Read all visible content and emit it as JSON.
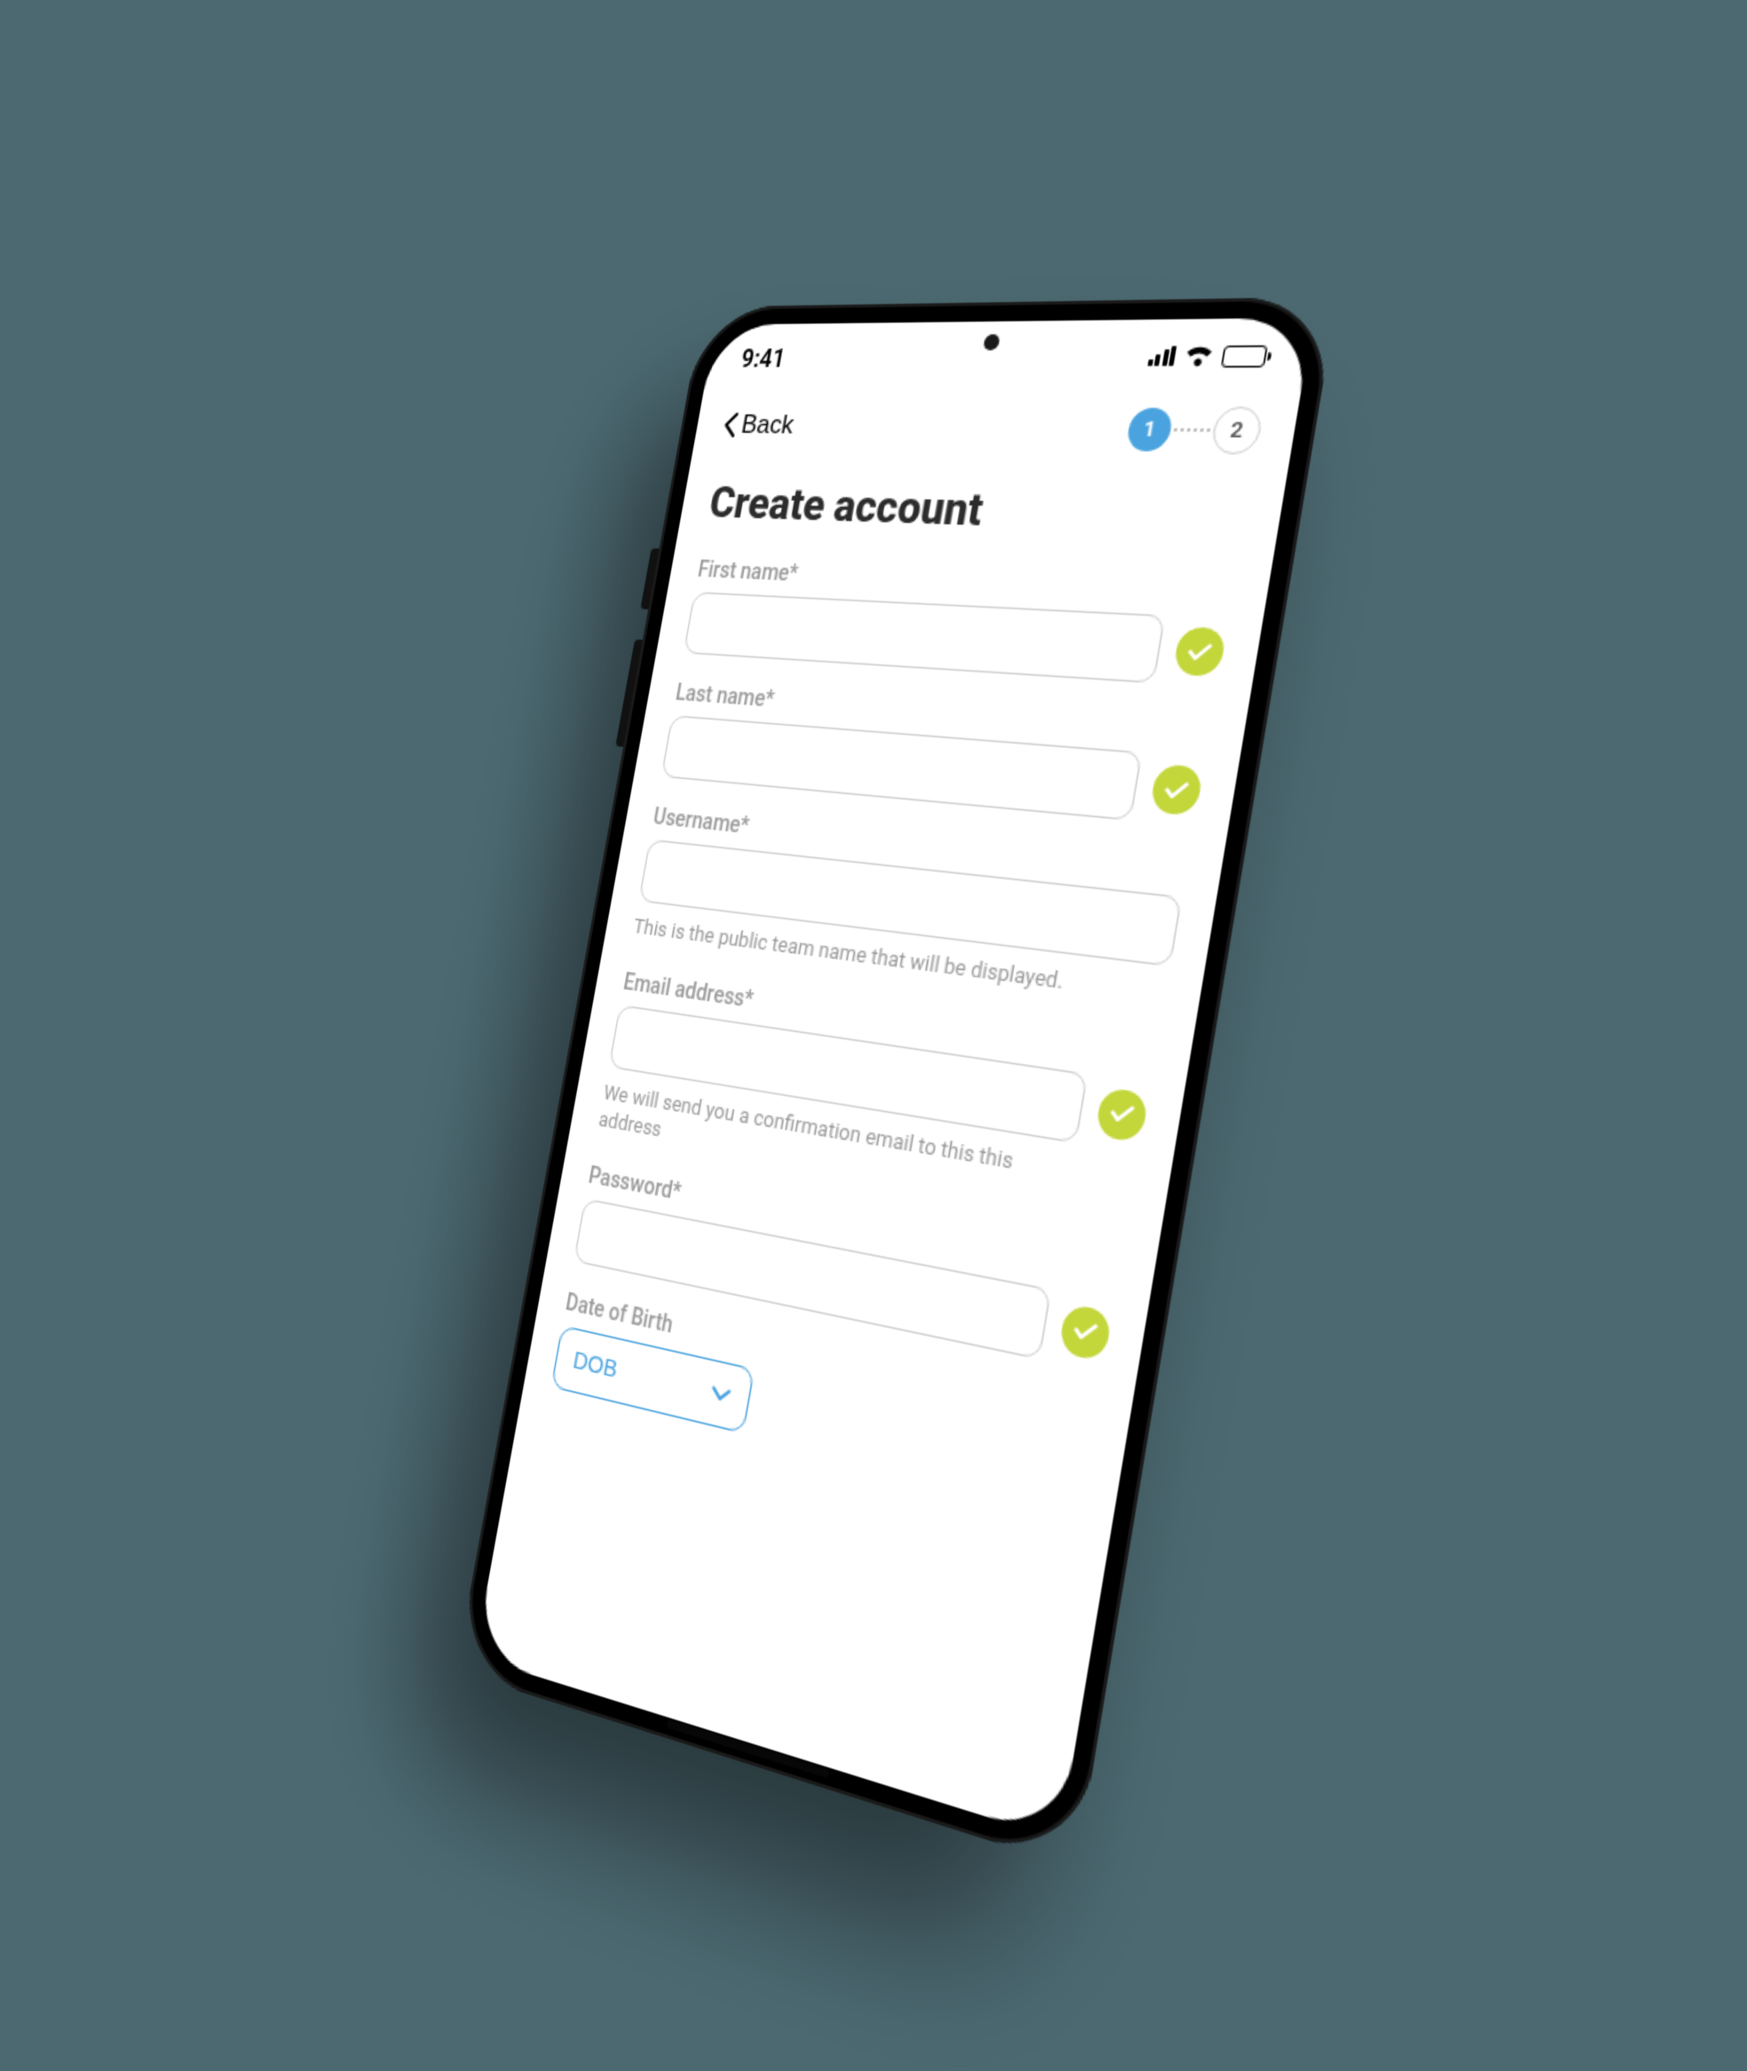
{
  "statusbar": {
    "time": "9:41"
  },
  "nav": {
    "back_label": "Back"
  },
  "stepper": {
    "step1": "1",
    "step2": "2"
  },
  "title": "Create account",
  "fields": {
    "first_name": {
      "label": "First name*",
      "valid": true
    },
    "last_name": {
      "label": "Last name*",
      "valid": true
    },
    "username": {
      "label": "Username*",
      "helper": "This is the public team name that will be displayed."
    },
    "email": {
      "label": "Email address*",
      "valid": true,
      "helper": "We will send you a confirmation email to this this address"
    },
    "password": {
      "label": "Password*",
      "valid": true
    },
    "dob": {
      "label": "Date of Birth",
      "select_label": "DOB"
    }
  }
}
